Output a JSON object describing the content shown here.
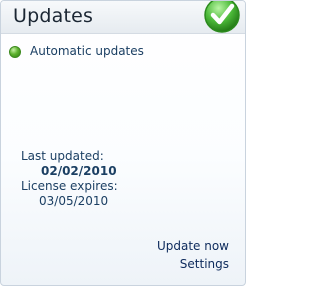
{
  "panel": {
    "title": "Updates",
    "status_icon": "check-icon",
    "status_color": "#3fb34f"
  },
  "status": {
    "icon": "green-dot-icon",
    "label": "Automatic updates"
  },
  "info": {
    "last_updated_label": "Last updated:",
    "last_updated_value": "02/02/2010",
    "license_label": "License expires:",
    "license_value": "03/05/2010"
  },
  "links": {
    "update_now": "Update now",
    "settings": "Settings"
  }
}
